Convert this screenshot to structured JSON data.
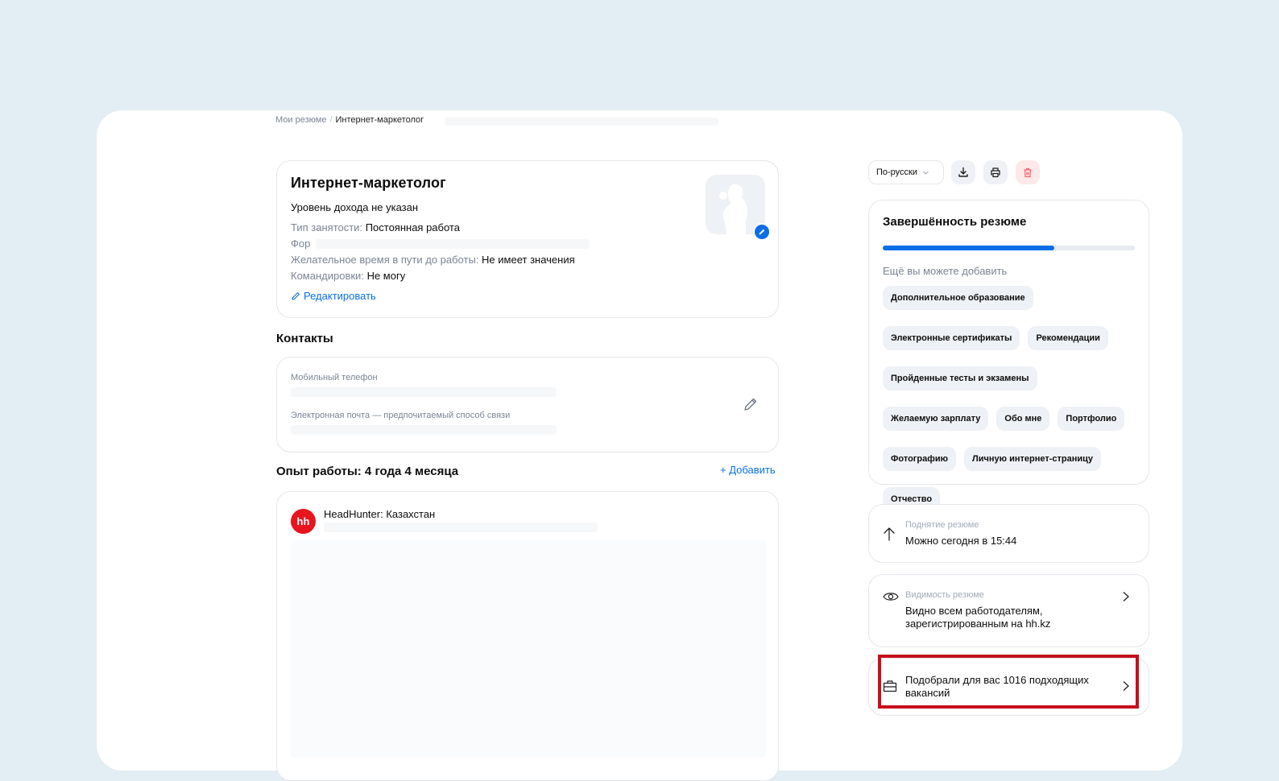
{
  "breadcrumb": {
    "root": "Мои резюме",
    "separator": "/",
    "current": "Интернет-маркетолог"
  },
  "resume": {
    "title": "Интернет-маркетолог",
    "salary": "Уровень дохода не указан",
    "employment_label": "Тип занятости:",
    "employment_value": "Постоянная работа",
    "format_label": "Фор",
    "commute_label": "Желательное время в пути до работы:",
    "commute_value": "Не имеет значения",
    "trips_label": "Командировки:",
    "trips_value": "Не могу",
    "edit_label": "Редактировать"
  },
  "contacts": {
    "heading": "Контакты",
    "phone_label": "Мобильный телефон",
    "email_label": "Электронная почта — предпочитаемый способ связи"
  },
  "experience": {
    "heading": "Опыт работы: 4 года 4 месяца",
    "add_label": "+ Добавить",
    "company_logo": "hh",
    "company": "HeadHunter: Казахстан"
  },
  "toolbar": {
    "language": "По-русски",
    "download_icon": "download-icon",
    "print_icon": "print-icon",
    "delete_icon": "trash-icon"
  },
  "completion": {
    "heading": "Завершённость резюме",
    "progress": 0.68,
    "subheading": "Ещё вы можете добавить",
    "chips": [
      "Дополнительное образование",
      "Электронные сертификаты",
      "Рекомендации",
      "Пройденные тесты и экзамены",
      "Желаемую зарплату",
      "Обо мне",
      "Портфолио",
      "Фотографию",
      "Личную интернет-страницу",
      "Отчество"
    ]
  },
  "raise": {
    "label": "Поднятие резюме",
    "value": "Можно сегодня в 15:44"
  },
  "visibility": {
    "label": "Видимость резюме",
    "value": "Видно всем работодателям, зарегистрированным на hh.kz"
  },
  "vacancies": {
    "text": "Подобрали для вас 1016 подходящих вакансий"
  },
  "colors": {
    "accent": "#0b6ee6",
    "danger": "#e8141e",
    "highlight": "#c60f1d",
    "background": "#e3edf4"
  }
}
